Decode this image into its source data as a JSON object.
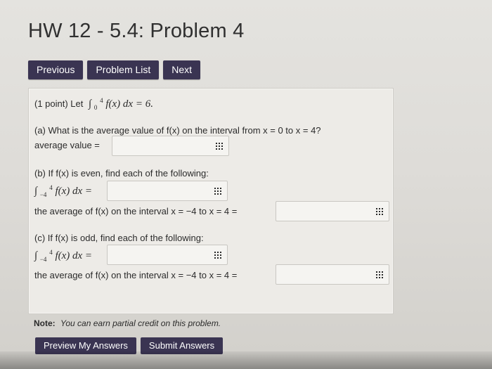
{
  "page": {
    "title": "HW 12 - 5.4: Problem 4",
    "nav": {
      "previous": "Previous",
      "problem_list": "Problem List",
      "next": "Next"
    }
  },
  "problem": {
    "intro_prefix": "(1 point) Let",
    "intro_integral": "∫",
    "intro_lower": "0",
    "intro_upper": "4",
    "intro_expr": "f(x) dx = 6.",
    "part_a": {
      "question": "(a) What is the average value of f(x) on the interval from x = 0 to x = 4?",
      "answer_label": "average value =",
      "answer_value": ""
    },
    "part_b": {
      "question": "(b) If f(x) is even, find each of the following:",
      "integral_prefix": "∫",
      "integral_lower": "−4",
      "integral_upper": "4",
      "integral_expr": "f(x) dx =",
      "integral_value": "",
      "average_label": "the average of f(x) on the interval x = −4 to x = 4 =",
      "average_value": ""
    },
    "part_c": {
      "question": "(c) If f(x) is odd, find each of the following:",
      "integral_prefix": "∫",
      "integral_lower": "−4",
      "integral_upper": "4",
      "integral_expr": "f(x) dx =",
      "integral_value": "",
      "average_label": "the average of f(x) on the interval x = −4 to x = 4 =",
      "average_value": ""
    }
  },
  "note": {
    "label": "Note:",
    "text": "You can earn partial credit on this problem."
  },
  "footer": {
    "preview": "Preview My Answers",
    "submit": "Submit Answers"
  },
  "colors": {
    "button_bg": "#3a3452",
    "panel_bg": "#edebe7",
    "page_bg": "#dedcd8"
  }
}
